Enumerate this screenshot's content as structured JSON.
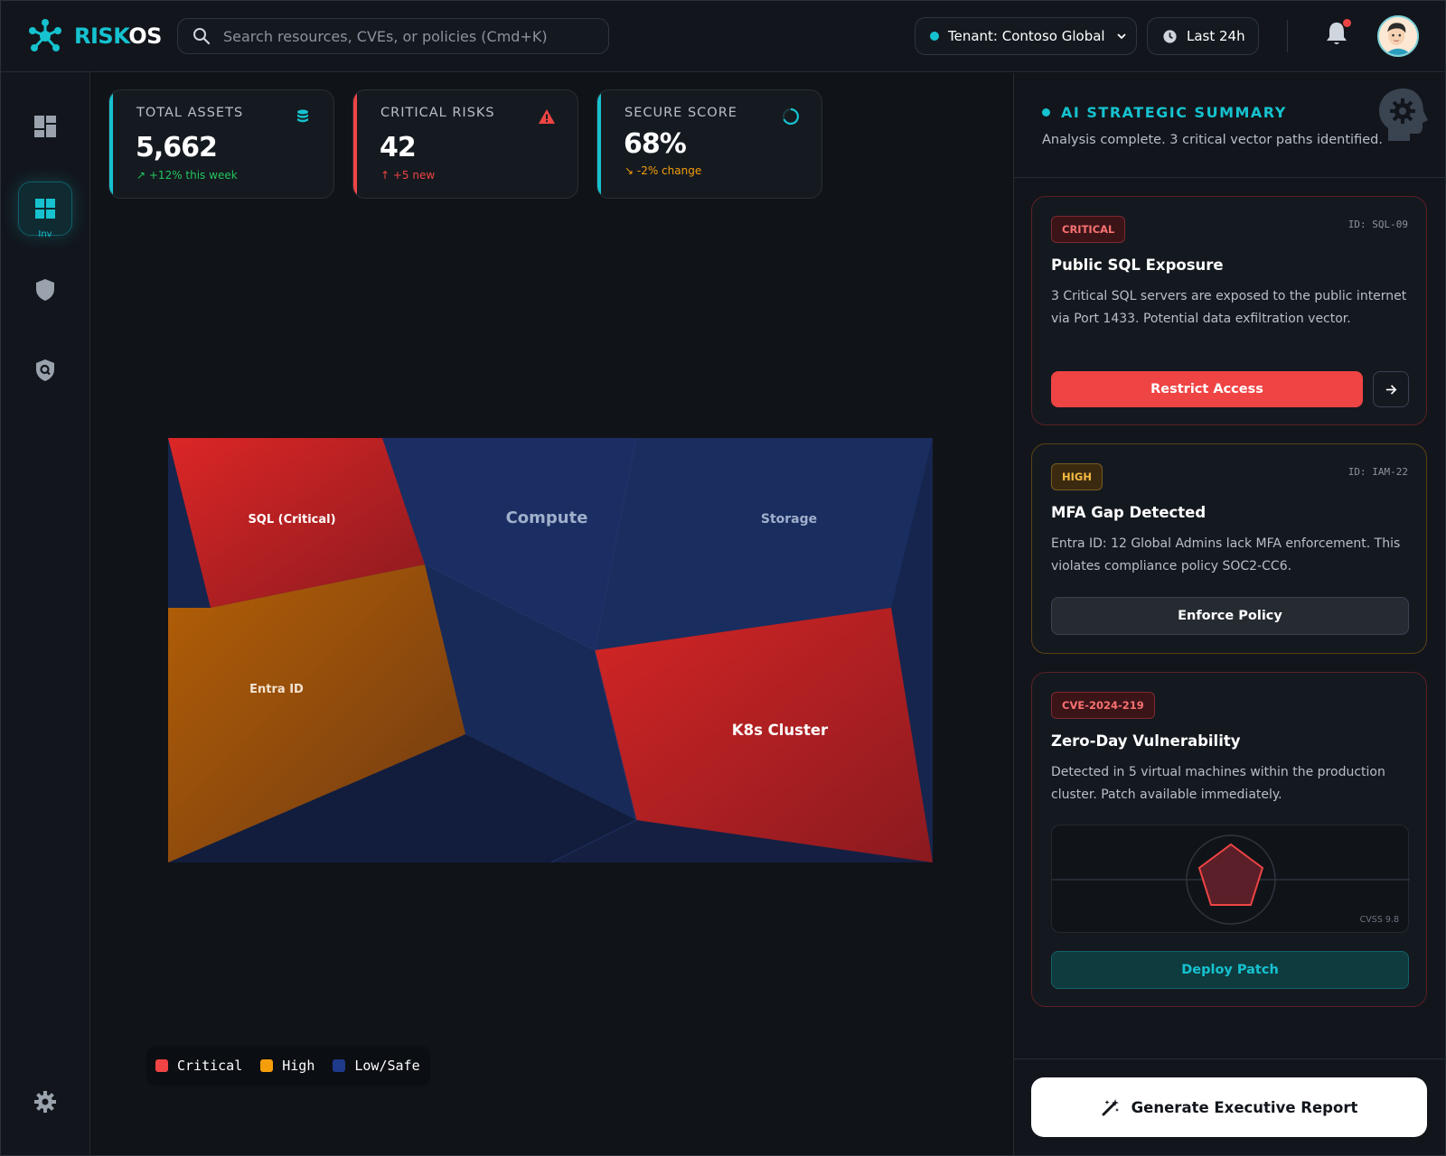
{
  "app": {
    "logo_a": "RISK",
    "logo_b": "OS"
  },
  "search": {
    "placeholder": "Search resources, CVEs, or policies (Cmd+K)"
  },
  "header": {
    "tenant": "Tenant: Contoso Global",
    "time_range": "Last 24h"
  },
  "sidebar": {
    "active_label": "Inv"
  },
  "kpis": [
    {
      "label": "TOTAL ASSETS",
      "value": "5,662",
      "delta": "+12% this week",
      "color": "#16c2cf",
      "delta_color": "#22c55e",
      "icon": "database-icon"
    },
    {
      "label": "CRITICAL RISKS",
      "value": "42",
      "delta": "+5 new",
      "color": "#ef4444",
      "delta_color": "#ef4444",
      "icon": "warning-icon"
    },
    {
      "label": "SECURE SCORE",
      "value": "68%",
      "delta": "-2% change",
      "color": "#16c2cf",
      "delta_color": "#f59e0b",
      "icon": "progress-ring-icon"
    }
  ],
  "treemap": {
    "cells": [
      "SQL (Critical)",
      "Compute",
      "Storage",
      "Entra ID",
      "K8s Cluster"
    ]
  },
  "legend": [
    {
      "label": "Critical",
      "color": "#ef4444"
    },
    {
      "label": "High",
      "color": "#f59e0b"
    },
    {
      "label": "Low/Safe",
      "color": "#1e3a8a"
    }
  ],
  "summary": {
    "title": "AI STRATEGIC SUMMARY",
    "subtitle": "Analysis complete. 3 critical vector paths identified."
  },
  "cards": [
    {
      "badge": "CRITICAL",
      "id": "ID: SQL-09",
      "title": "Public SQL Exposure",
      "desc": "3 Critical SQL servers are exposed to the public internet via Port 1433. Potential data exfiltration vector.",
      "action": "Restrict Access",
      "accent": "#ef4444"
    },
    {
      "badge": "HIGH",
      "id": "ID: IAM-22",
      "title": "MFA Gap Detected",
      "desc": "Entra ID: 12 Global Admins lack MFA enforcement. This violates compliance policy SOC2-CC6.",
      "action": "Enforce Policy",
      "accent": "#f59e0b"
    },
    {
      "badge": "CVE-2024-219",
      "title": "Zero-Day Vulnerability",
      "desc": "Detected in 5 virtual machines within the production cluster. Patch available immediately.",
      "action": "Deploy Patch",
      "accent": "#ef4444",
      "cvss": "CVSS 9.8"
    }
  ],
  "report_button": "Generate Executive Report"
}
